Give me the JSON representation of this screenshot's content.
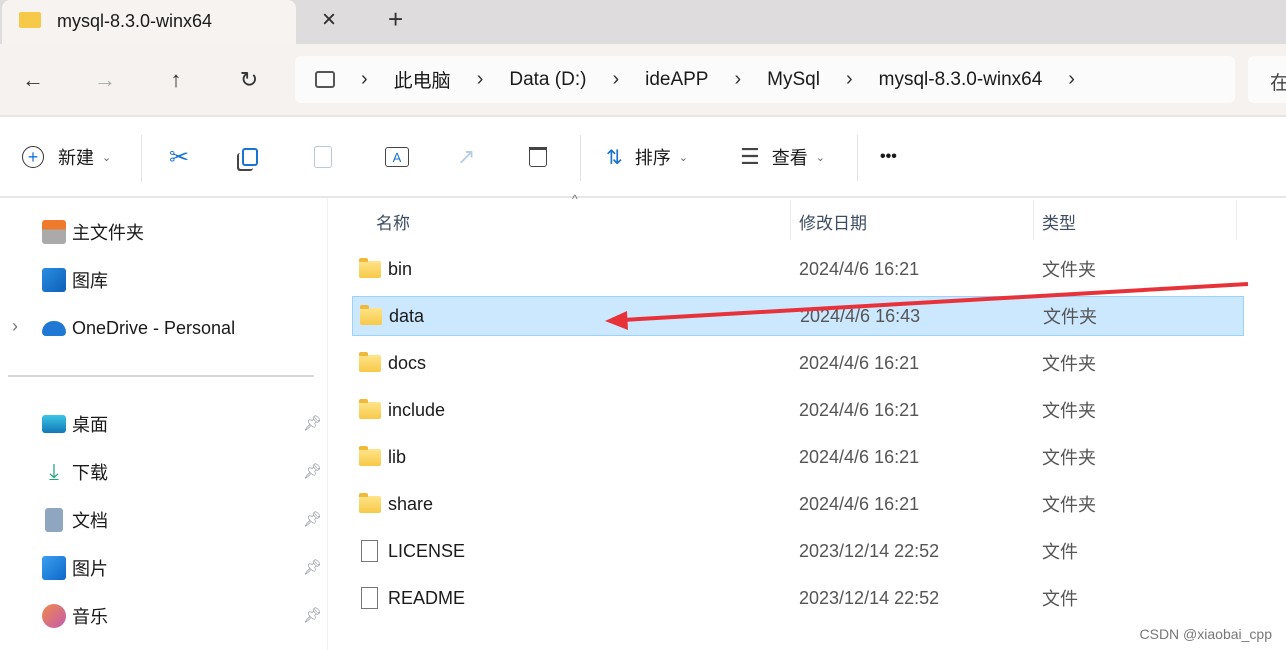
{
  "tab": {
    "title": "mysql-8.3.0-winx64",
    "close": "×",
    "new_tab": "+"
  },
  "nav": {
    "back": "←",
    "forward": "→",
    "up": "↑",
    "refresh": "↻"
  },
  "breadcrumb": [
    "此电脑",
    "Data (D:)",
    "ideAPP",
    "MySql",
    "mysql-8.3.0-winx64"
  ],
  "search_placeholder": "在",
  "toolbar": {
    "new_label": "新建",
    "sort_label": "排序",
    "view_label": "查看",
    "more": "•••"
  },
  "sidebar": {
    "items": [
      {
        "label": "主文件夹",
        "icon": "home-icon"
      },
      {
        "label": "图库",
        "icon": "gallery-icon"
      },
      {
        "label": "OneDrive - Personal",
        "icon": "onedrive-icon"
      }
    ],
    "pinned": [
      {
        "label": "桌面",
        "icon": "desktop-icon"
      },
      {
        "label": "下载",
        "icon": "download-icon"
      },
      {
        "label": "文档",
        "icon": "documents-icon"
      },
      {
        "label": "图片",
        "icon": "pictures-icon"
      },
      {
        "label": "音乐",
        "icon": "music-icon"
      }
    ]
  },
  "columns": {
    "name": "名称",
    "date": "修改日期",
    "type": "类型"
  },
  "files": [
    {
      "name": "bin",
      "date": "2024/4/6 16:21",
      "type": "文件夹",
      "kind": "folder"
    },
    {
      "name": "data",
      "date": "2024/4/6 16:43",
      "type": "文件夹",
      "kind": "folder",
      "selected": true
    },
    {
      "name": "docs",
      "date": "2024/4/6 16:21",
      "type": "文件夹",
      "kind": "folder"
    },
    {
      "name": "include",
      "date": "2024/4/6 16:21",
      "type": "文件夹",
      "kind": "folder"
    },
    {
      "name": "lib",
      "date": "2024/4/6 16:21",
      "type": "文件夹",
      "kind": "folder"
    },
    {
      "name": "share",
      "date": "2024/4/6 16:21",
      "type": "文件夹",
      "kind": "folder"
    },
    {
      "name": "LICENSE",
      "date": "2023/12/14 22:52",
      "type": "文件",
      "kind": "file"
    },
    {
      "name": "README",
      "date": "2023/12/14 22:52",
      "type": "文件",
      "kind": "file"
    }
  ],
  "annotation": {
    "color": "#e8323a"
  },
  "watermark": "CSDN @xiaobai_cpp"
}
